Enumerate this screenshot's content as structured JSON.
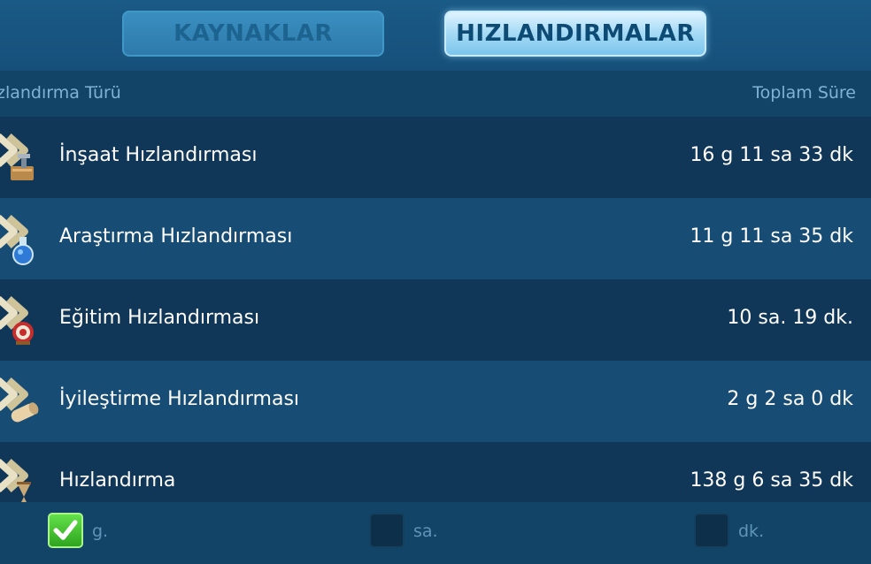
{
  "tabs": {
    "resources_label": "KAYNAKLAR",
    "speedups_label": "HIZLANDIRMALAR",
    "active": "HIZLANDIRMALAR"
  },
  "table": {
    "col_type": "zlandırma Türü",
    "col_total": "Toplam Süre",
    "rows": [
      {
        "name": "İnşaat Hızlandırması",
        "total": "16 g 11 sa 33 dk",
        "icon": "construction-speedup-icon"
      },
      {
        "name": "Araştırma Hızlandırması",
        "total": "11 g 11 sa 35 dk",
        "icon": "research-speedup-icon"
      },
      {
        "name": "Eğitim Hızlandırması",
        "total": "10 sa. 19 dk.",
        "icon": "training-speedup-icon"
      },
      {
        "name": "İyileştirme Hızlandırması",
        "total": "2 g 2 sa 0 dk",
        "icon": "healing-speedup-icon"
      },
      {
        "name": "Hızlandırma",
        "total": "138 g 6 sa 35 dk",
        "icon": "universal-speedup-icon"
      }
    ]
  },
  "footer": {
    "days_label": "g.",
    "hours_label": "sa.",
    "minutes_label": "dk.",
    "days_checked": true,
    "hours_checked": false,
    "minutes_checked": false
  },
  "colors": {
    "background": "#0f3a5a",
    "active_tab": "#a9dcf6",
    "checkbox_on": "#3fbf2a"
  }
}
